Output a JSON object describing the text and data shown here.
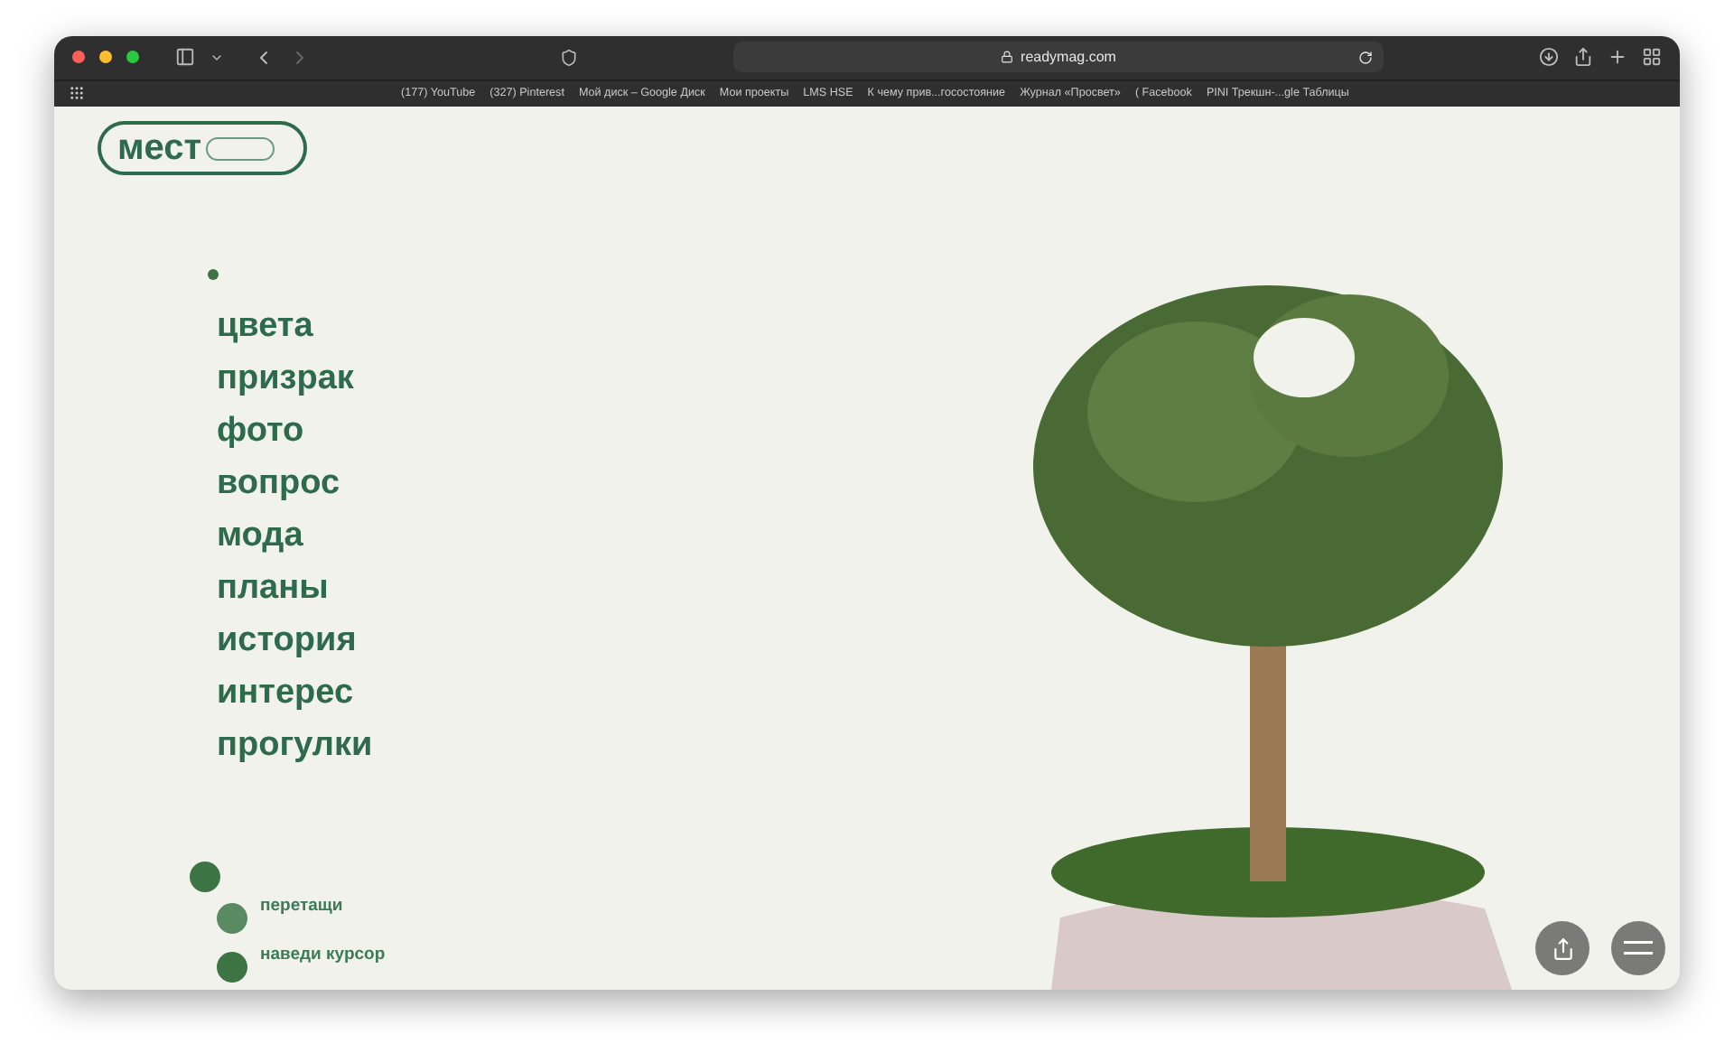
{
  "browser": {
    "url": "readymag.com",
    "bookmarks": [
      "(177) YouTube",
      "(327) Pinterest",
      "Мой диск – Google Диск",
      "Мои проекты",
      "LMS HSE",
      "К чему прив...госостояние",
      "Журнал «Просвет»",
      "( Facebook",
      "PINI Трекшн-...gle Таблицы"
    ]
  },
  "logo": {
    "text": "мест"
  },
  "menu": [
    "цвета",
    "призрак",
    "фото",
    "вопрос",
    "мода",
    "планы",
    "история",
    "интерес",
    "прогулки"
  ],
  "hints": [
    {
      "text": "перетащи",
      "color": "#5a8a62"
    },
    {
      "text": "наведи курсор",
      "color": "#3d7444"
    }
  ]
}
